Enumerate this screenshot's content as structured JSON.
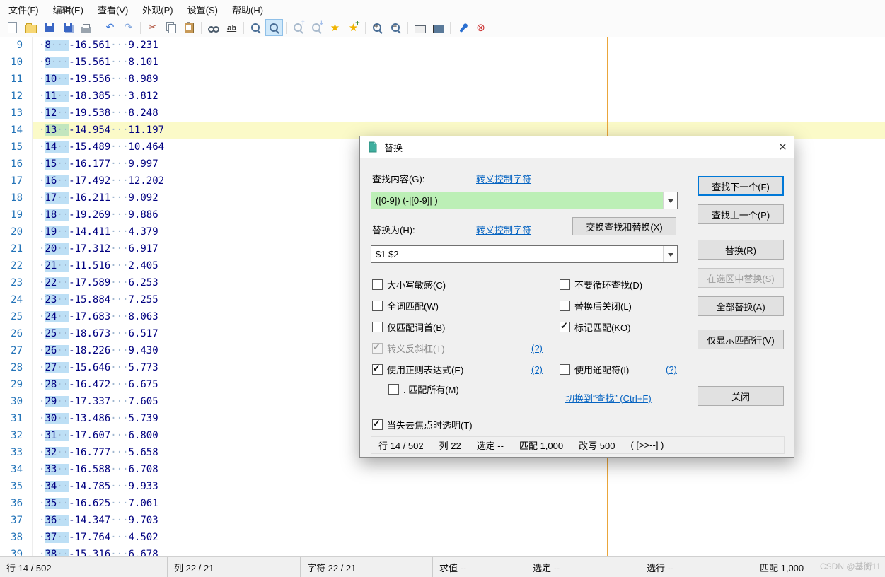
{
  "menu": {
    "items": [
      {
        "key": "file",
        "label": "文件(F)"
      },
      {
        "key": "edit",
        "label": "编辑(E)"
      },
      {
        "key": "view",
        "label": "查看(V)"
      },
      {
        "key": "appearance",
        "label": "外观(P)"
      },
      {
        "key": "settings",
        "label": "设置(S)"
      },
      {
        "key": "help",
        "label": "帮助(H)"
      }
    ]
  },
  "toolbar": {
    "items": [
      {
        "name": "new-file-icon",
        "type": "page"
      },
      {
        "name": "open-file-icon",
        "type": "folder"
      },
      {
        "name": "save-icon",
        "type": "floppy"
      },
      {
        "name": "save-all-icon",
        "type": "floppy2"
      },
      {
        "name": "print-icon",
        "type": "print"
      },
      {
        "type": "sep"
      },
      {
        "name": "undo-icon",
        "type": "undo"
      },
      {
        "name": "redo-icon",
        "type": "redo"
      },
      {
        "type": "sep"
      },
      {
        "name": "cut-icon",
        "type": "cut"
      },
      {
        "name": "copy-icon",
        "type": "copy"
      },
      {
        "name": "paste-icon",
        "type": "paste"
      },
      {
        "type": "sep"
      },
      {
        "name": "find-icon",
        "type": "binoc"
      },
      {
        "name": "replace-icon",
        "type": "ab"
      },
      {
        "type": "sep"
      },
      {
        "name": "find-in-files-icon",
        "type": "mag"
      },
      {
        "name": "highlight-search-icon",
        "type": "magbox",
        "pressed": true
      },
      {
        "type": "sep"
      },
      {
        "name": "find-previous-icon",
        "type": "magup",
        "disabled": true
      },
      {
        "name": "find-next-icon",
        "type": "magdown",
        "disabled": true
      },
      {
        "name": "bookmark-icon",
        "type": "star"
      },
      {
        "name": "add-bookmark-icon",
        "type": "starplus"
      },
      {
        "type": "sep"
      },
      {
        "name": "zoom-in-icon",
        "type": "magplus"
      },
      {
        "name": "zoom-out-icon",
        "type": "magminus"
      },
      {
        "type": "sep"
      },
      {
        "name": "character-map-icon",
        "type": "keyboard"
      },
      {
        "name": "fullscreen-icon",
        "type": "screen"
      },
      {
        "type": "sep"
      },
      {
        "name": "pin-icon",
        "type": "pin"
      },
      {
        "name": "stop-icon",
        "type": "cancel"
      }
    ]
  },
  "editor": {
    "current_line": 14,
    "rows": [
      {
        "n": 9,
        "m": "8···",
        "rest": "-16.561···9.231"
      },
      {
        "n": 10,
        "m": "9···",
        "rest": "-15.561···8.101"
      },
      {
        "n": 11,
        "m": "10··",
        "rest": "-19.556···8.989"
      },
      {
        "n": 12,
        "m": "11··",
        "rest": "-18.385···3.812"
      },
      {
        "n": 13,
        "m": "12··",
        "rest": "-19.538···8.248"
      },
      {
        "n": 14,
        "m": "13··",
        "rest": "-14.954···11.197"
      },
      {
        "n": 15,
        "m": "14··",
        "rest": "-15.489···10.464"
      },
      {
        "n": 16,
        "m": "15··",
        "rest": "-16.177···9.997"
      },
      {
        "n": 17,
        "m": "16··",
        "rest": "-17.492···12.202"
      },
      {
        "n": 18,
        "m": "17··",
        "rest": "-16.211···9.092"
      },
      {
        "n": 19,
        "m": "18··",
        "rest": "-19.269···9.886"
      },
      {
        "n": 20,
        "m": "19··",
        "rest": "-14.411···4.379"
      },
      {
        "n": 21,
        "m": "20··",
        "rest": "-17.312···6.917"
      },
      {
        "n": 22,
        "m": "21··",
        "rest": "-11.516···2.405"
      },
      {
        "n": 23,
        "m": "22··",
        "rest": "-17.589···6.253"
      },
      {
        "n": 24,
        "m": "23··",
        "rest": "-15.884···7.255"
      },
      {
        "n": 25,
        "m": "24··",
        "rest": "-17.683···8.063"
      },
      {
        "n": 26,
        "m": "25··",
        "rest": "-18.673···6.517"
      },
      {
        "n": 27,
        "m": "26··",
        "rest": "-18.226···9.430"
      },
      {
        "n": 28,
        "m": "27··",
        "rest": "-15.646···5.773"
      },
      {
        "n": 29,
        "m": "28··",
        "rest": "-16.472···6.675"
      },
      {
        "n": 30,
        "m": "29··",
        "rest": "-17.337···7.605"
      },
      {
        "n": 31,
        "m": "30··",
        "rest": "-13.486···5.739"
      },
      {
        "n": 32,
        "m": "31··",
        "rest": "-17.607···6.800"
      },
      {
        "n": 33,
        "m": "32··",
        "rest": "-16.777···5.658"
      },
      {
        "n": 34,
        "m": "33··",
        "rest": "-16.588···6.708"
      },
      {
        "n": 35,
        "m": "34··",
        "rest": "-14.785···9.933"
      },
      {
        "n": 36,
        "m": "35··",
        "rest": "-16.625···7.061"
      },
      {
        "n": 37,
        "m": "36··",
        "rest": "-14.347···9.703"
      },
      {
        "n": 38,
        "m": "37··",
        "rest": "-17.764···4.502"
      },
      {
        "n": 39,
        "m": "38··",
        "rest": "-15.316···6.678"
      }
    ]
  },
  "dialog": {
    "title": "替换",
    "find_label": "查找内容(G):",
    "escape_link": "转义控制字符",
    "find_value": "([0-9]) (-|[0-9]| )",
    "replace_label": "替换为(H):",
    "swap_label": "交换查找和替换(X)",
    "replace_value": "$1 $2",
    "help_label": "(?)",
    "switch_label": "切换到“查找” (Ctrl+F)",
    "transparent_label": "当失去焦点时透明(T)",
    "left_checks": [
      {
        "key": "match-case",
        "label": "大小写敏感(C)",
        "checked": false
      },
      {
        "key": "whole-word",
        "label": "全词匹配(W)",
        "checked": false
      },
      {
        "key": "word-start",
        "label": "仅匹配词首(B)",
        "checked": false
      },
      {
        "key": "escape-backslash",
        "label": "转义反斜杠(T)",
        "checked": true,
        "disabled": true
      },
      {
        "key": "use-regex",
        "label": "使用正则表达式(E)",
        "checked": true
      },
      {
        "key": "dot-matches-all",
        "label": ". 匹配所有(M)",
        "checked": false,
        "indent": true
      }
    ],
    "right_checks": [
      {
        "key": "no-wrap-search",
        "label": "不要循环查找(D)",
        "checked": false
      },
      {
        "key": "close-on-replace",
        "label": "替换后关闭(L)",
        "checked": false
      },
      {
        "key": "mark-matches",
        "label": "标记匹配(KO)",
        "checked": true
      },
      {
        "key": "use-wildcards",
        "label": "使用通配符(I)",
        "checked": false
      }
    ],
    "status_items": [
      "行 14 / 502",
      "列 22",
      "选定 --",
      "匹配 1,000",
      "改写 500",
      "( [>>--] )"
    ],
    "buttons": [
      {
        "key": "find-next",
        "label": "查找下一个(F)",
        "default": true
      },
      {
        "key": "find-previous",
        "label": "查找上一个(P)"
      },
      {
        "key": "replace",
        "label": "替换(R)"
      },
      {
        "key": "replace-in-selection",
        "label": "在选区中替换(S)",
        "disabled": true
      },
      {
        "key": "replace-all",
        "label": "全部替换(A)"
      },
      {
        "key": "show-matched-lines",
        "label": "仅显示匹配行(V)"
      },
      {
        "key": "close",
        "label": "关闭"
      }
    ]
  },
  "statusbar": {
    "segments": [
      "行 14 / 502",
      "列 22 / 21",
      "字符 22 / 21",
      "求值 --",
      "选定 --",
      "选行 --",
      "匹配 1,000"
    ],
    "watermark": "CSDN @基衡11"
  }
}
